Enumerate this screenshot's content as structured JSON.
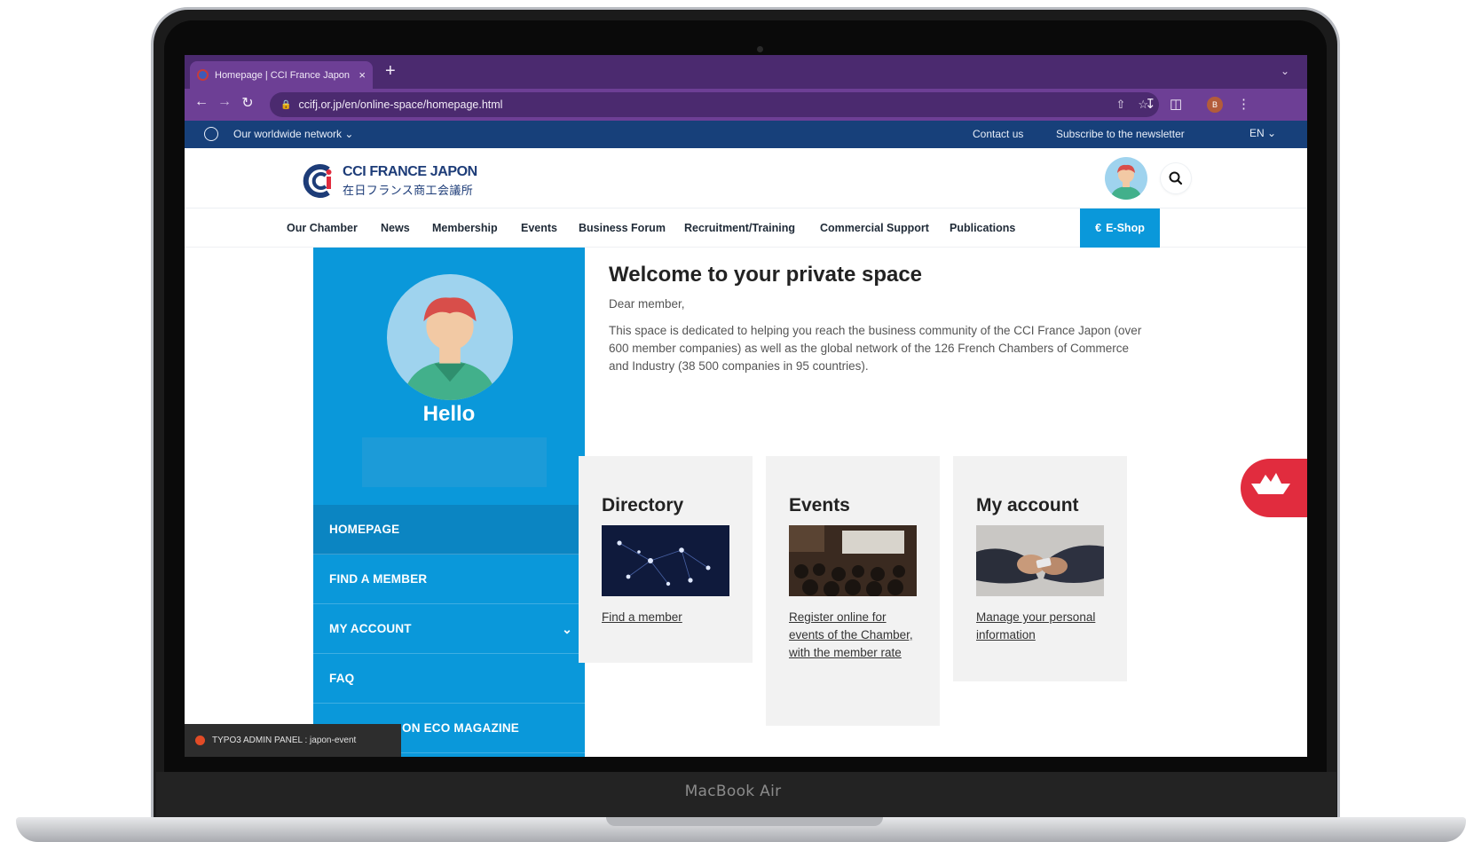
{
  "device": {
    "brand": "MacBook Air"
  },
  "browser": {
    "tab_title": "Homepage | CCI France Japon",
    "tab_close": "×",
    "new_tab": "+",
    "url": "ccifj.or.jp/en/online-space/homepage.html"
  },
  "topbar": {
    "network": "Our worldwide network",
    "contact": "Contact us",
    "newsletter": "Subscribe to the newsletter",
    "lang": "EN"
  },
  "header": {
    "logo_name": "CCI FRANCE JAPON",
    "logo_sub": "在日フランス商工会議所"
  },
  "nav": {
    "items": [
      "Our Chamber",
      "News",
      "Membership",
      "Events",
      "Business Forum",
      "Recruitment/Training",
      "Commercial Support",
      "Publications"
    ],
    "eshop": "E-Shop",
    "eshop_symbol": "€"
  },
  "sidebar": {
    "hello": "Hello",
    "menu": [
      "HOMEPAGE",
      "FIND A MEMBER",
      "MY ACCOUNT",
      "FAQ",
      "ON ECO MAGAZINE"
    ]
  },
  "admin_panel": {
    "label": "TYPO3 ADMIN PANEL : japon-event"
  },
  "main": {
    "title": "Welcome to your private space",
    "greeting": "Dear member,",
    "intro": "This space is dedicated to helping you reach the business community of the CCI France Japon (over 600 member companies) as well as the global network of the 126 French Chambers of Commerce and Industry (38 500 companies in 95 countries).",
    "cards": [
      {
        "title": "Directory",
        "link": "Find a member"
      },
      {
        "title": "Events",
        "link": "Register online for events of the Chamber, with the member rate"
      },
      {
        "title": "My account",
        "link": "Manage your personal information"
      }
    ]
  },
  "colors": {
    "browser_purple": "#6d3f95",
    "topbar_navy": "#17407a",
    "accent_blue": "#0a98da",
    "badge_red": "#e12c3e"
  }
}
